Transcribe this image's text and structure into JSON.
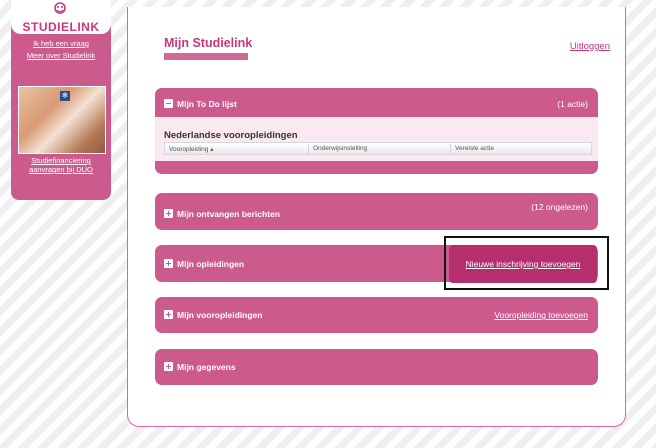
{
  "sidebar": {
    "logo_text": "STUDIELINK",
    "links": [
      "Ik heb een vraag",
      "Meer over Studielink"
    ],
    "photo_caption_1": "Studiefinanciering",
    "photo_caption_2": "aanvragen bij DUO"
  },
  "header": {
    "title": "Mijn Studielink",
    "logout": "Uitloggen"
  },
  "sections": {
    "todo": {
      "label": "Mijn To Do lijst",
      "count": "(1 actie)",
      "subtitle": "Nederlandse vooropleidingen",
      "columns": [
        "Vooropleiding ▴",
        "Onderwijsinstelling",
        "Vereiste actie"
      ]
    },
    "berichten": {
      "label": "Mijn ontvangen berichten",
      "count": "(12 ongelezen)"
    },
    "opleidingen": {
      "label": "Mijn opleidingen",
      "action": "Nieuwe inschrijving toevoegen"
    },
    "vooropleidingen": {
      "label": "Mijn vooropleidingen",
      "action": "Vooropleiding toevoegen"
    },
    "gegevens": {
      "label": "Mijn gegevens"
    }
  },
  "colors": {
    "brand": "#cc5a8c",
    "brand_dark": "#b52e6e",
    "title": "#c9377a"
  }
}
